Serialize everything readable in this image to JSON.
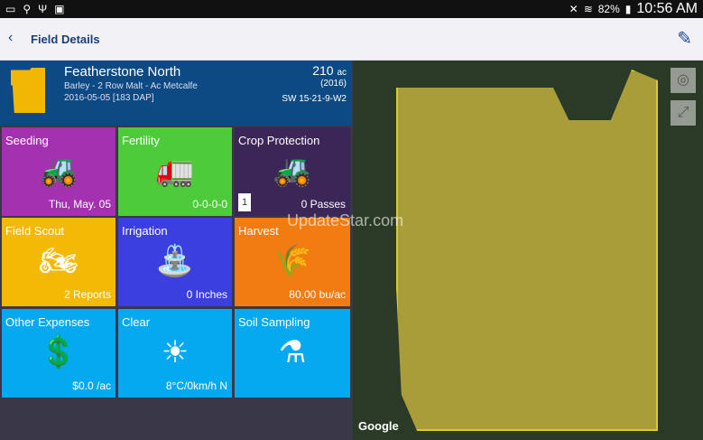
{
  "status_bar": {
    "battery": "82%",
    "time": "10:56 AM"
  },
  "app_bar": {
    "title": "Field Details"
  },
  "field": {
    "name": "Featherstone North",
    "crop": "Barley - 2 Row Malt - Ac Metcalfe",
    "date": "2016-05-05 [183 DAP]",
    "acres": "210",
    "acres_unit": "ac",
    "year": "(2016)",
    "legal": "SW 15-21-9-W2"
  },
  "tiles": [
    {
      "title": "Seeding",
      "value": "Thu, May. 05",
      "color": "#a432b0"
    },
    {
      "title": "Fertility",
      "value": "0-0-0-0",
      "color": "#4dcb3b"
    },
    {
      "title": "Crop Protection",
      "value": "0 Passes",
      "badge": "1",
      "color": "#3c2658"
    },
    {
      "title": "Field Scout",
      "value": "2 Reports",
      "color": "#f4b905"
    },
    {
      "title": "Irrigation",
      "value": "0 Inches",
      "color": "#3b3fe0"
    },
    {
      "title": "Harvest",
      "value": "80.00 bu/ac",
      "color": "#f27c12"
    },
    {
      "title": "Other Expenses",
      "value": "$0.0 /ac",
      "color": "#05a9ef"
    },
    {
      "title": "Clear",
      "value": "8°C/0km/h N",
      "color": "#05a9ef"
    },
    {
      "title": "Soil Sampling",
      "value": "",
      "color": "#05a9ef"
    }
  ],
  "map": {
    "attribution": "Google"
  },
  "watermark": "UpdateStar.com"
}
